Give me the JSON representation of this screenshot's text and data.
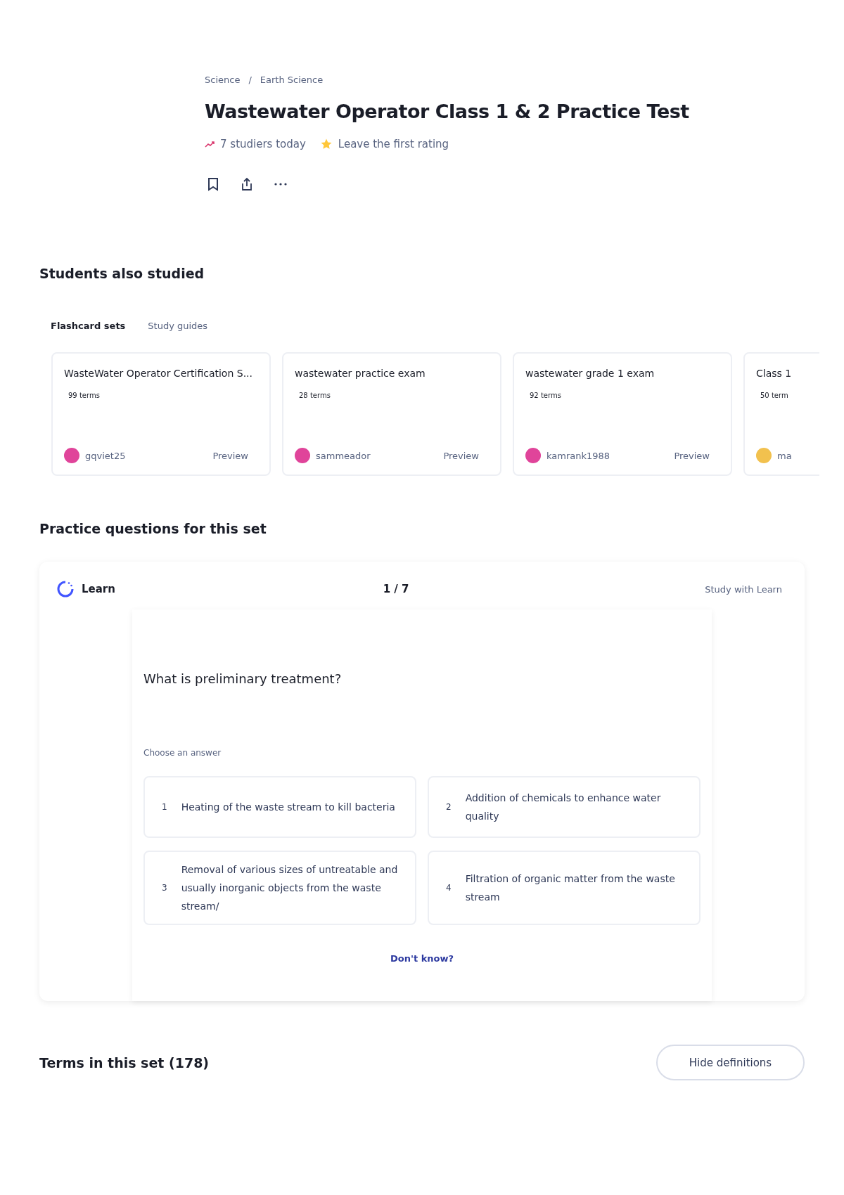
{
  "breadcrumb": [
    "Science",
    "Earth Science"
  ],
  "breadcrumb_separator": "/",
  "title": "Wastewater Operator Class 1 & 2 Practice Test",
  "meta": {
    "studiers": "7 studiers today",
    "rating": "Leave the first rating"
  },
  "also_studied": {
    "heading": "Students also studied",
    "tabs": [
      {
        "label": "Flashcard sets",
        "selected": true
      },
      {
        "label": "Study guides",
        "selected": false
      }
    ],
    "cards": [
      {
        "title": "WasteWater Operator Certification S...",
        "terms": "99 terms",
        "author": "gqviet25",
        "color": "#e0449a",
        "preview": "Preview"
      },
      {
        "title": "wastewater practice exam",
        "terms": "28 terms",
        "author": "sammeador",
        "color": "#e0449a",
        "preview": "Preview"
      },
      {
        "title": "wastewater grade 1 exam",
        "terms": "92 terms",
        "author": "kamrank1988",
        "color": "#e0449a",
        "preview": "Preview"
      },
      {
        "title": "Class 1",
        "terms": "50 term",
        "author": "ma",
        "color": "#f2c14e"
      }
    ]
  },
  "practice": {
    "heading": "Practice questions for this set",
    "mode": "Learn",
    "progress": "1 / 7",
    "study_link": "Study with Learn",
    "question": "What is preliminary treatment?",
    "prompt": "Choose an answer",
    "answers": [
      {
        "number": "1",
        "text": "Heating of the waste stream to kill bacteria"
      },
      {
        "number": "2",
        "text": "Addition of chemicals to enhance water quality"
      },
      {
        "number": "3",
        "text": "Removal of various sizes of untreatable and usually inorganic objects from the waste stream/"
      },
      {
        "number": "4",
        "text": "Filtration of organic matter from the waste stream"
      }
    ],
    "dont_know": "Don't know?"
  },
  "terms": {
    "heading": "Terms in this set (178)",
    "button": "Hide definitions"
  }
}
